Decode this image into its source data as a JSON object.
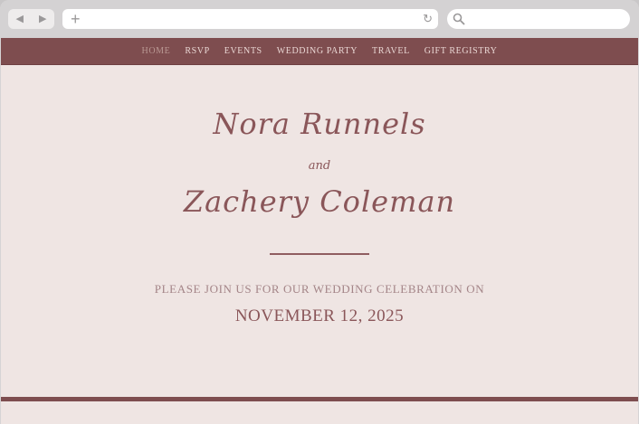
{
  "browser": {
    "back_icon": "back-arrow-icon",
    "forward_icon": "forward-arrow-icon",
    "new_tab_icon": "plus-icon",
    "reload_icon": "reload-icon",
    "search_icon": "search-icon",
    "url_value": "",
    "search_value": ""
  },
  "nav": {
    "items": [
      {
        "label": "HOME"
      },
      {
        "label": "RSVP"
      },
      {
        "label": "EVENTS"
      },
      {
        "label": "WEDDING PARTY"
      },
      {
        "label": "TRAVEL"
      },
      {
        "label": "GIFT REGISTRY"
      }
    ]
  },
  "hero": {
    "name1": "Nora Runnels",
    "and": "and",
    "name2": "Zachery Coleman",
    "invite": "PLEASE JOIN US FOR OUR WEDDING CELEBRATION ON",
    "date": "NOVEMBER 12, 2025"
  },
  "colors": {
    "accent": "#7e4d4f",
    "background": "#efe5e3",
    "script_text": "#8a5659"
  }
}
